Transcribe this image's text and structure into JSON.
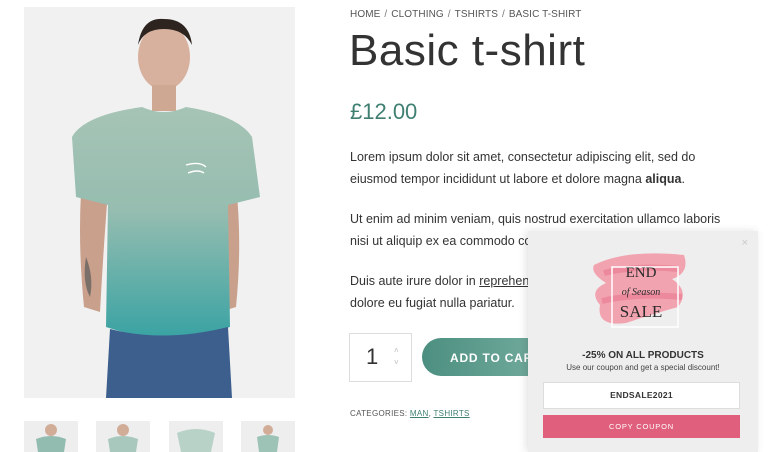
{
  "breadcrumb": {
    "items": [
      "HOME",
      "CLOTHING",
      "TSHIRTS",
      "BASIC T-SHIRT"
    ],
    "separator": "/"
  },
  "product": {
    "title": "Basic t-shirt",
    "price": "£12.00",
    "paragraph1": "Lorem ipsum dolor sit amet, consectetur adipiscing elit, sed do",
    "paragraph1_line2_start": "eiusmod tempor incididunt ut labore et dolore magna ",
    "paragraph1_bold": "aliqua",
    "paragraph1_end": ".",
    "paragraph2_line1": "Ut enim ad minim veniam, quis nostrud exercitation ullamco laboris",
    "paragraph2_line2": "nisi ut aliquip ex ea commodo con",
    "paragraph3_line1_start": "Duis aute irure dolor in ",
    "paragraph3_link": "reprehende",
    "paragraph3_line2": "dolore eu fugiat nulla pariatur.",
    "quantity": "1",
    "add_to_cart": "ADD TO CART",
    "categories_label": "CATEGORIES: ",
    "categories": [
      "MAN",
      "TSHIRTS"
    ]
  },
  "popup": {
    "close": "×",
    "logo_top": "END",
    "logo_middle": "of Season",
    "logo_bottom": "SALE",
    "headline": "-25% ON ALL PRODUCTS",
    "subtext": "Use our coupon and get a special discount!",
    "coupon_code": "ENDSALE2021",
    "copy_button": "COPY COUPON"
  },
  "colors": {
    "accent": "#3f7f72",
    "button_gradient_start": "#4c8f80",
    "popup_button": "#df5f7d",
    "shirt": "#9fbfb1"
  }
}
